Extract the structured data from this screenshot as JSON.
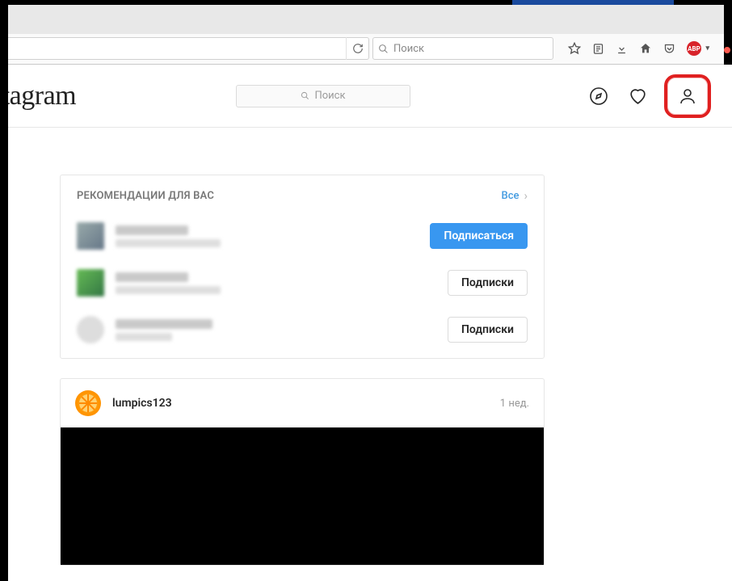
{
  "browser": {
    "search_placeholder": "Поиск"
  },
  "app": {
    "logo_text": "stagram",
    "search_placeholder": "Поиск"
  },
  "suggestions": {
    "title": "РЕКОМЕНДАЦИИ ДЛЯ ВАС",
    "all_label": "Все",
    "items": [
      {
        "button": "Подписаться",
        "primary": true
      },
      {
        "button": "Подписки",
        "primary": false
      },
      {
        "button": "Подписки",
        "primary": false
      }
    ]
  },
  "post": {
    "username": "lumpics123",
    "time": "1 нед."
  }
}
